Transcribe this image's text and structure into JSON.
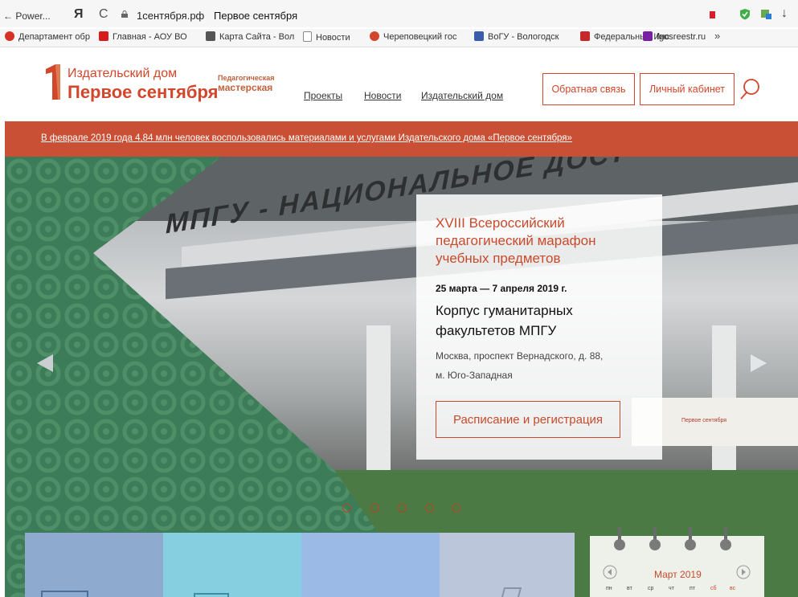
{
  "browser": {
    "back_label": "Power...",
    "yandex_label": "Я",
    "reload_label": "C",
    "domain": "1сентября.рф",
    "page_title": "Первое сентября",
    "download_label": "↓",
    "more_label": "»",
    "bookmarks": [
      {
        "label": "Департамент обр",
        "color": "#d93025"
      },
      {
        "label": "Главная - АОУ ВО",
        "color": "#d81b1b"
      },
      {
        "label": "Карта Сайта - Вол",
        "color": "#555555"
      },
      {
        "label": "Новости",
        "color": "#888888"
      },
      {
        "label": "Череповецкий гос",
        "color": "#d2462b"
      },
      {
        "label": "ВоГУ - Вологодск",
        "color": "#3b5bab"
      },
      {
        "label": "Федеральный Инс",
        "color": "#c62828"
      },
      {
        "label": "fgosreestr.ru",
        "color": "#7b1fa2"
      }
    ]
  },
  "header": {
    "logo_line1": "Издательский дом",
    "logo_line2": "Первое сентября",
    "ped_line1": "Педагогическая",
    "ped_line2": "мастерская",
    "menu": [
      "Проекты",
      "Новости",
      "Издательский дом"
    ],
    "feedback_label": "Обратная связь",
    "cabinet_label": "Личный кабинет"
  },
  "banner": {
    "text": "В феврале 2019 года 4,84 млн человек воспользовались материалами и услугами Издательского дома «Первое сентября»"
  },
  "hero": {
    "slogan": "МПГУ - НАЦИОНАЛЬНОЕ ДОСТ",
    "title": "XVIII Всероссийский педагогический марафон учебных предметов",
    "dates": "25 марта — 7 апреля 2019 г.",
    "venue": "Корпус гуманитарных факультетов МПГУ",
    "address": "Москва, проспект Вернадского, д. 88,",
    "metro": "м. Юго-Западная",
    "register_label": "Расписание и регистрация",
    "poster_text": "Первое сентября"
  },
  "calendar": {
    "month": "Март 2019",
    "weekdays": [
      "пн",
      "вт",
      "ср",
      "чт",
      "пт",
      "сб",
      "вс"
    ]
  },
  "colors": {
    "accent": "#d2462b",
    "banner": "#c94f35",
    "hero_green": "#4b7a45"
  }
}
